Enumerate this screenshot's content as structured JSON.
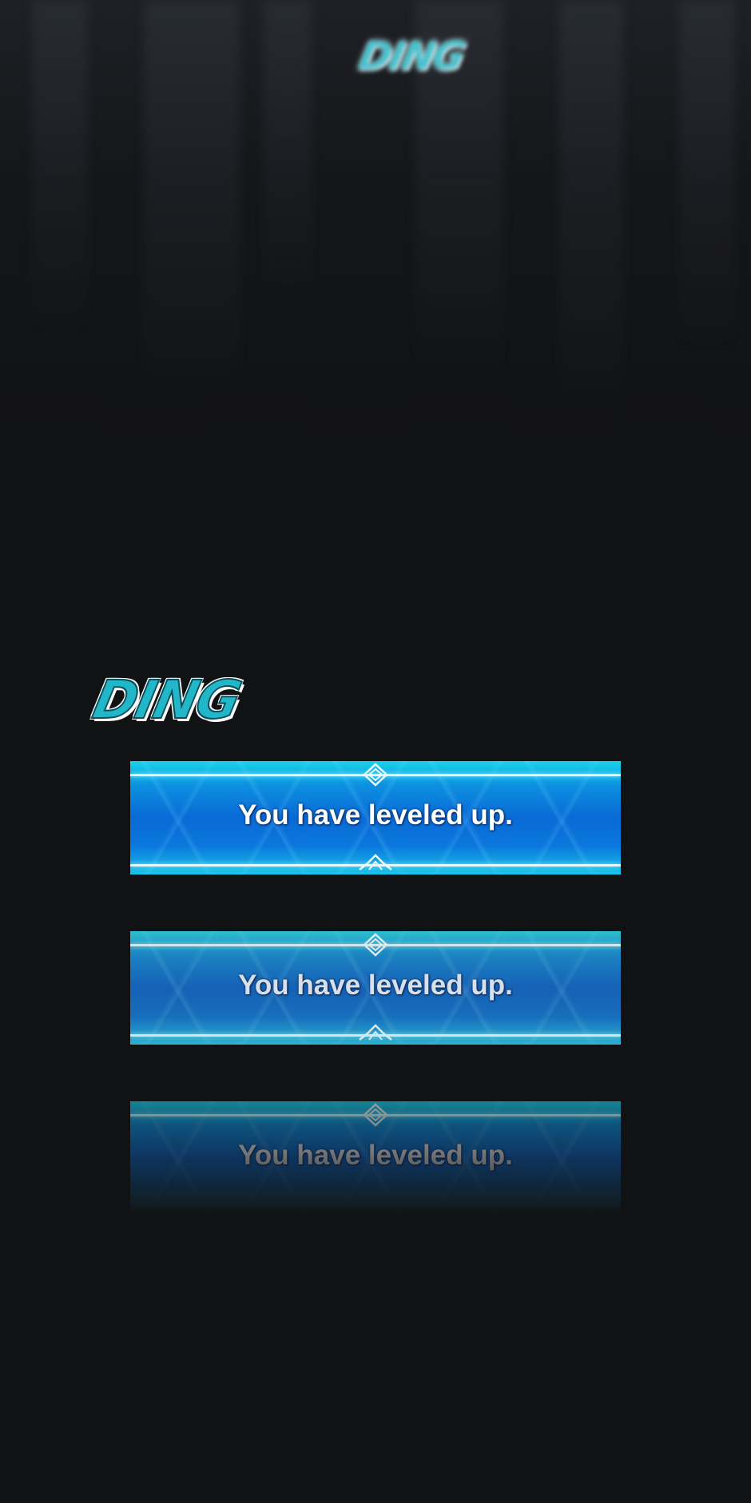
{
  "panel": {
    "sfx_top": "DING",
    "sfx_main": "DING",
    "notifications": [
      {
        "message": "You have leveled up."
      },
      {
        "message": "You have leveled up."
      },
      {
        "message": "You have leveled up."
      }
    ]
  },
  "colors": {
    "background": "#111213",
    "sfx_cyan": "#22b6c9",
    "banner_blue": "#0a6ad6",
    "banner_cyan": "#19d3ea",
    "banner_line": "#dff9ff"
  },
  "icons": [
    "diamond-ornament-icon",
    "chevron-ornament-icon"
  ]
}
